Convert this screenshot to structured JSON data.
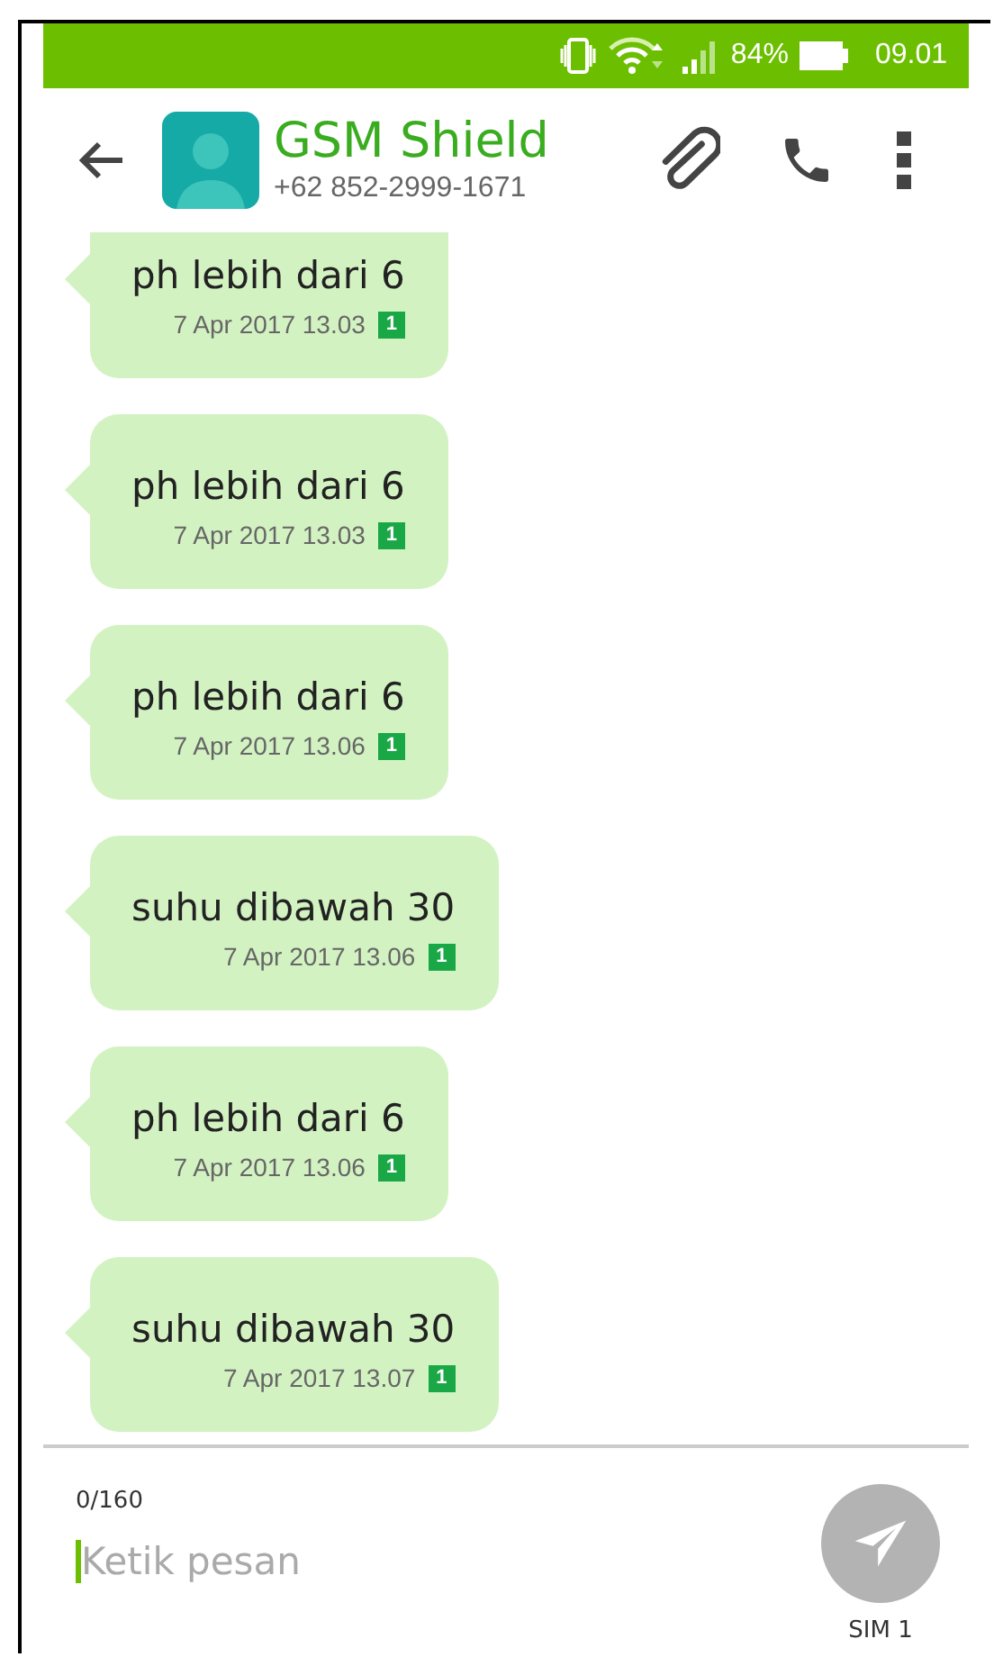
{
  "status_bar": {
    "battery": "84%",
    "time": "09.01"
  },
  "header": {
    "contact_name": "GSM Shield",
    "phone": "+62 852-2999-1671"
  },
  "messages": [
    {
      "text": "ph lebih dari 6",
      "time": "7 Apr 2017 13.03",
      "sim": "1"
    },
    {
      "text": "ph lebih dari 6",
      "time": "7 Apr 2017 13.03",
      "sim": "1"
    },
    {
      "text": "ph lebih dari 6",
      "time": "7 Apr 2017 13.06",
      "sim": "1"
    },
    {
      "text": "suhu dibawah 30",
      "time": "7 Apr 2017 13.06",
      "sim": "1"
    },
    {
      "text": "ph lebih dari 6",
      "time": "7 Apr 2017 13.06",
      "sim": "1"
    },
    {
      "text": "suhu dibawah 30",
      "time": "7 Apr 2017 13.07",
      "sim": "1"
    }
  ],
  "composer": {
    "counter": "0/160",
    "placeholder": "Ketik pesan",
    "send_sim": "SIM 1"
  }
}
